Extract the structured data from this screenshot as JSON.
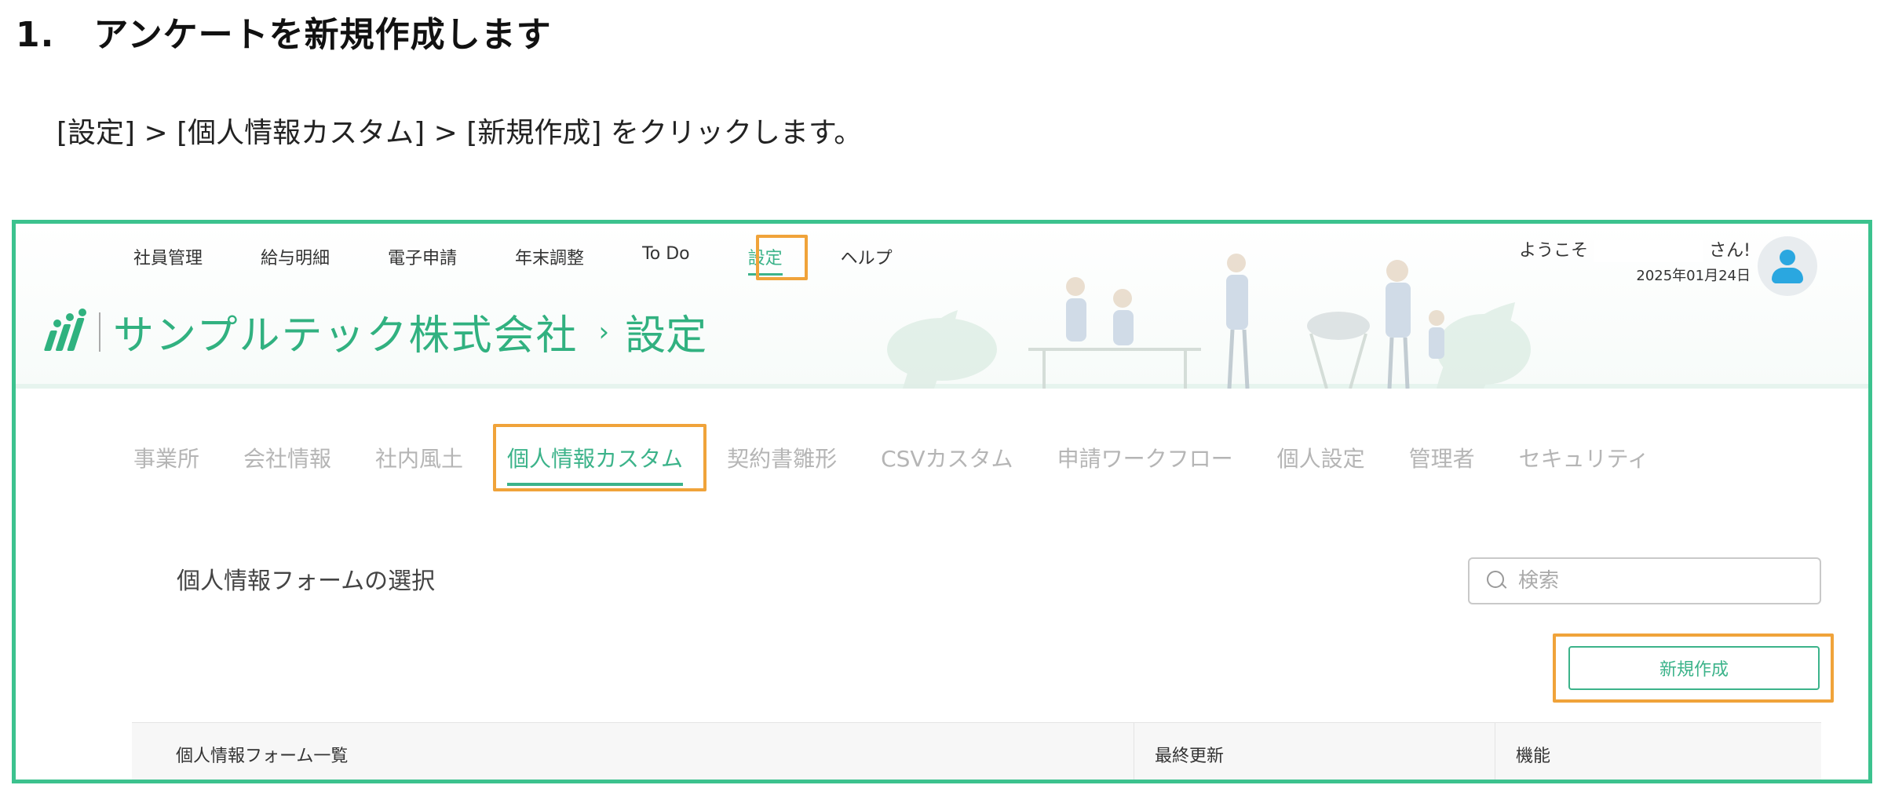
{
  "document": {
    "step_number": "1.",
    "step_title": "アンケートを新規作成します",
    "instruction": "[設定] > [個人情報カスタム] > [新規作成] をクリックします。"
  },
  "app": {
    "topnav": [
      "社員管理",
      "給与明細",
      "電子申請",
      "年末調整",
      "To Do",
      "設定",
      "ヘルプ"
    ],
    "active_topnav": "設定",
    "welcome_prefix": "ようこそ",
    "welcome_suffix": "さん!",
    "date": "2025年01月24日",
    "company_name": "サンプルテック株式会社",
    "breadcrumb_separator": "›",
    "page_title": "設定",
    "tabs": [
      "事業所",
      "会社情報",
      "社内風土",
      "個人情報カスタム",
      "契約書雛形",
      "CSVカスタム",
      "申請ワークフロー",
      "個人設定",
      "管理者",
      "セキュリティ"
    ],
    "active_tab": "個人情報カスタム",
    "section_title": "個人情報フォームの選択",
    "search_placeholder": "検索",
    "new_button_label": "新規作成",
    "table_headers": {
      "name": "個人情報フォーム一覧",
      "updated": "最終更新",
      "function": "機能"
    }
  },
  "colors": {
    "accent": "#3cb38a",
    "frame": "#3cc28e",
    "highlight": "#f0a33a",
    "inactive_tab": "#b5b5b5"
  }
}
